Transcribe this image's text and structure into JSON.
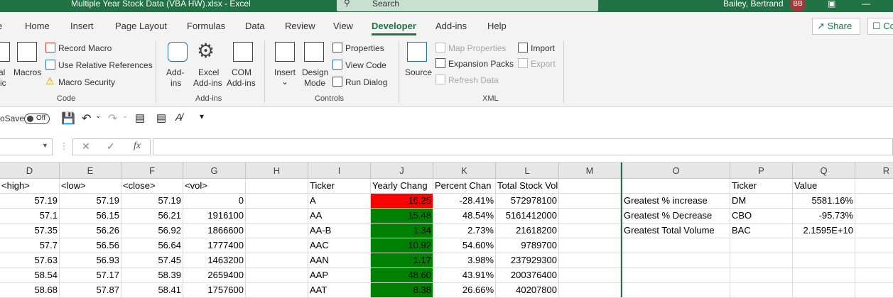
{
  "window": {
    "title": "Multiple Year Stock Data (VBA HW).xlsx  -  Excel",
    "search_placeholder": "Search",
    "user_name": "Bailey, Bertrand",
    "user_initials": "BB"
  },
  "tabs": [
    "e",
    "Home",
    "Insert",
    "Page Layout",
    "Formulas",
    "Data",
    "Review",
    "View",
    "Developer",
    "Add-ins",
    "Help"
  ],
  "active_tab": "Developer",
  "top_buttons": {
    "share": "Share",
    "comments": "Co"
  },
  "ribbon": {
    "code": {
      "label": "Code",
      "visual_basic": [
        "al",
        "ic"
      ],
      "macros": "Macros",
      "record_macro": "Record Macro",
      "relative_refs": "Use Relative References",
      "macro_security": "Macro Security"
    },
    "addins": {
      "label": "Add-ins",
      "addins": [
        "Add-",
        "ins"
      ],
      "excel_addins": [
        "Excel",
        "Add-ins"
      ],
      "com_addins": [
        "COM",
        "Add-ins"
      ]
    },
    "controls": {
      "label": "Controls",
      "insert": "Insert",
      "design_mode": [
        "Design",
        "Mode"
      ],
      "properties": "Properties",
      "view_code": "View Code",
      "run_dialog": "Run Dialog"
    },
    "xml": {
      "label": "XML",
      "source": "Source",
      "map_properties": "Map Properties",
      "expansion_packs": "Expansion Packs",
      "refresh_data": "Refresh Data",
      "import": "Import",
      "export": "Export"
    }
  },
  "qat": {
    "autosave_label": "oSave",
    "autosave_state": "Off"
  },
  "formula_bar": {
    "fx": "fx",
    "value": ""
  },
  "columns": [
    "D",
    "E",
    "F",
    "G",
    "H",
    "I",
    "J",
    "K",
    "L",
    "M",
    "O",
    "P",
    "Q",
    "R"
  ],
  "sheet_rows": [
    {
      "D": "<high>",
      "E": "<low>",
      "F": "<close>",
      "G": "<vol>",
      "H": "",
      "I": "Ticker",
      "J": "Yearly Chang",
      "K": "Percent Chan",
      "L": "Total Stock Volume",
      "M": "",
      "O": "",
      "P": "Ticker",
      "Q": "Value"
    },
    {
      "D": "57.19",
      "E": "57.19",
      "F": "57.19",
      "G": "0",
      "I": "A",
      "J": "-16.25",
      "K": "-28.41%",
      "L": "572978100",
      "O": "Greatest % increase",
      "P": "DM",
      "Q": "5581.16%"
    },
    {
      "D": "57.1",
      "E": "56.15",
      "F": "56.21",
      "G": "1916100",
      "I": "AA",
      "J": "15.48",
      "K": "48.54%",
      "L": "5161412000",
      "O": "Greatest % Decrease",
      "P": "CBO",
      "Q": "-95.73%"
    },
    {
      "D": "57.35",
      "E": "56.26",
      "F": "56.92",
      "G": "1866600",
      "I": "AA-B",
      "J": "1.34",
      "K": "2.73%",
      "L": "21618200",
      "O": "Greatest Total Volume",
      "P": "BAC",
      "Q": "2.1595E+10"
    },
    {
      "D": "57.7",
      "E": "56.56",
      "F": "56.64",
      "G": "1777400",
      "I": "AAC",
      "J": "10.92",
      "K": "54.60%",
      "L": "9789700"
    },
    {
      "D": "57.63",
      "E": "56.93",
      "F": "57.45",
      "G": "1463200",
      "I": "AAN",
      "J": "1.17",
      "K": "3.98%",
      "L": "237929300"
    },
    {
      "D": "58.54",
      "E": "57.17",
      "F": "58.39",
      "G": "2659400",
      "I": "AAP",
      "J": "48.60",
      "K": "43.91%",
      "L": "200376400"
    },
    {
      "D": "58.68",
      "E": "57.87",
      "F": "58.41",
      "G": "1757600",
      "I": "AAT",
      "J": "8.38",
      "K": "26.66%",
      "L": "40207800"
    }
  ],
  "colors": {
    "excel_green": "#217346",
    "negative": "#ff0000",
    "positive": "#008000"
  }
}
